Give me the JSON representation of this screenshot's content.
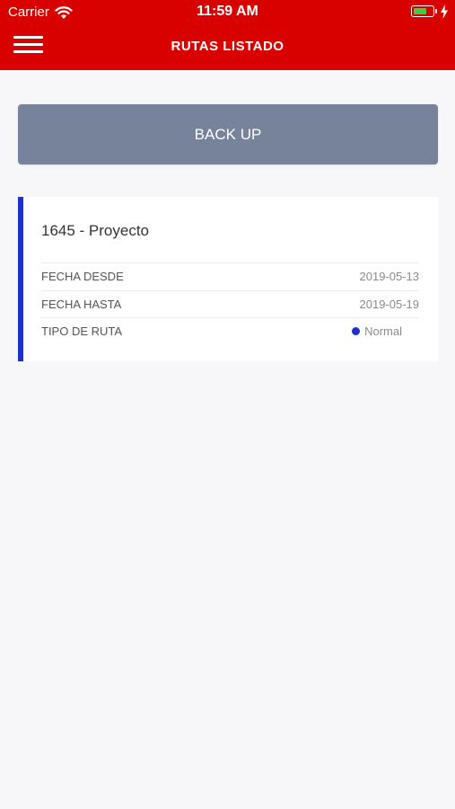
{
  "status_bar": {
    "carrier": "Carrier",
    "time": "11:59 AM",
    "battery_level": 0.7
  },
  "header": {
    "title": "RUTAS LISTADO",
    "menu_icon": "hamburger-menu-icon",
    "background_color": "#d90000"
  },
  "backup_button": {
    "label": "BACK UP",
    "color": "#77839b"
  },
  "route_card": {
    "title": "1645 - Proyecto",
    "accent_color": "#1c2fd0",
    "rows": [
      {
        "label": "FECHA DESDE",
        "value": "2019-05-13"
      },
      {
        "label": "FECHA HASTA",
        "value": "2019-05-19"
      },
      {
        "label": "TIPO DE RUTA",
        "value": "Normal",
        "status_color": "#1c2fd0"
      }
    ]
  }
}
